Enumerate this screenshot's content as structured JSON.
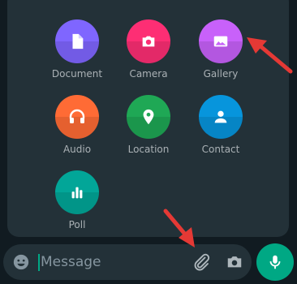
{
  "attach_menu": {
    "items": [
      {
        "label": "Document",
        "icon": "document-icon",
        "color": "#7f66ff"
      },
      {
        "label": "Camera",
        "icon": "camera-icon",
        "color": "#fd2e74"
      },
      {
        "label": "Gallery",
        "icon": "gallery-icon",
        "color": "#c861fa"
      },
      {
        "label": "Audio",
        "icon": "headphones-icon",
        "color": "#ff6b35"
      },
      {
        "label": "Location",
        "icon": "location-pin-icon",
        "color": "#1fa855"
      },
      {
        "label": "Contact",
        "icon": "contact-person-icon",
        "color": "#0795dc"
      },
      {
        "label": "Poll",
        "icon": "poll-icon",
        "color": "#02a698"
      }
    ]
  },
  "composer": {
    "placeholder": "Message",
    "emoji_icon": "emoji-icon",
    "attach_icon": "paperclip-icon",
    "camera_icon": "camera-icon",
    "mic_icon": "microphone-icon"
  },
  "colors": {
    "background": "#111b21",
    "panel": "#233138",
    "accent": "#00a884",
    "label": "#aab1b5",
    "annotation_arrow": "#e53935"
  }
}
